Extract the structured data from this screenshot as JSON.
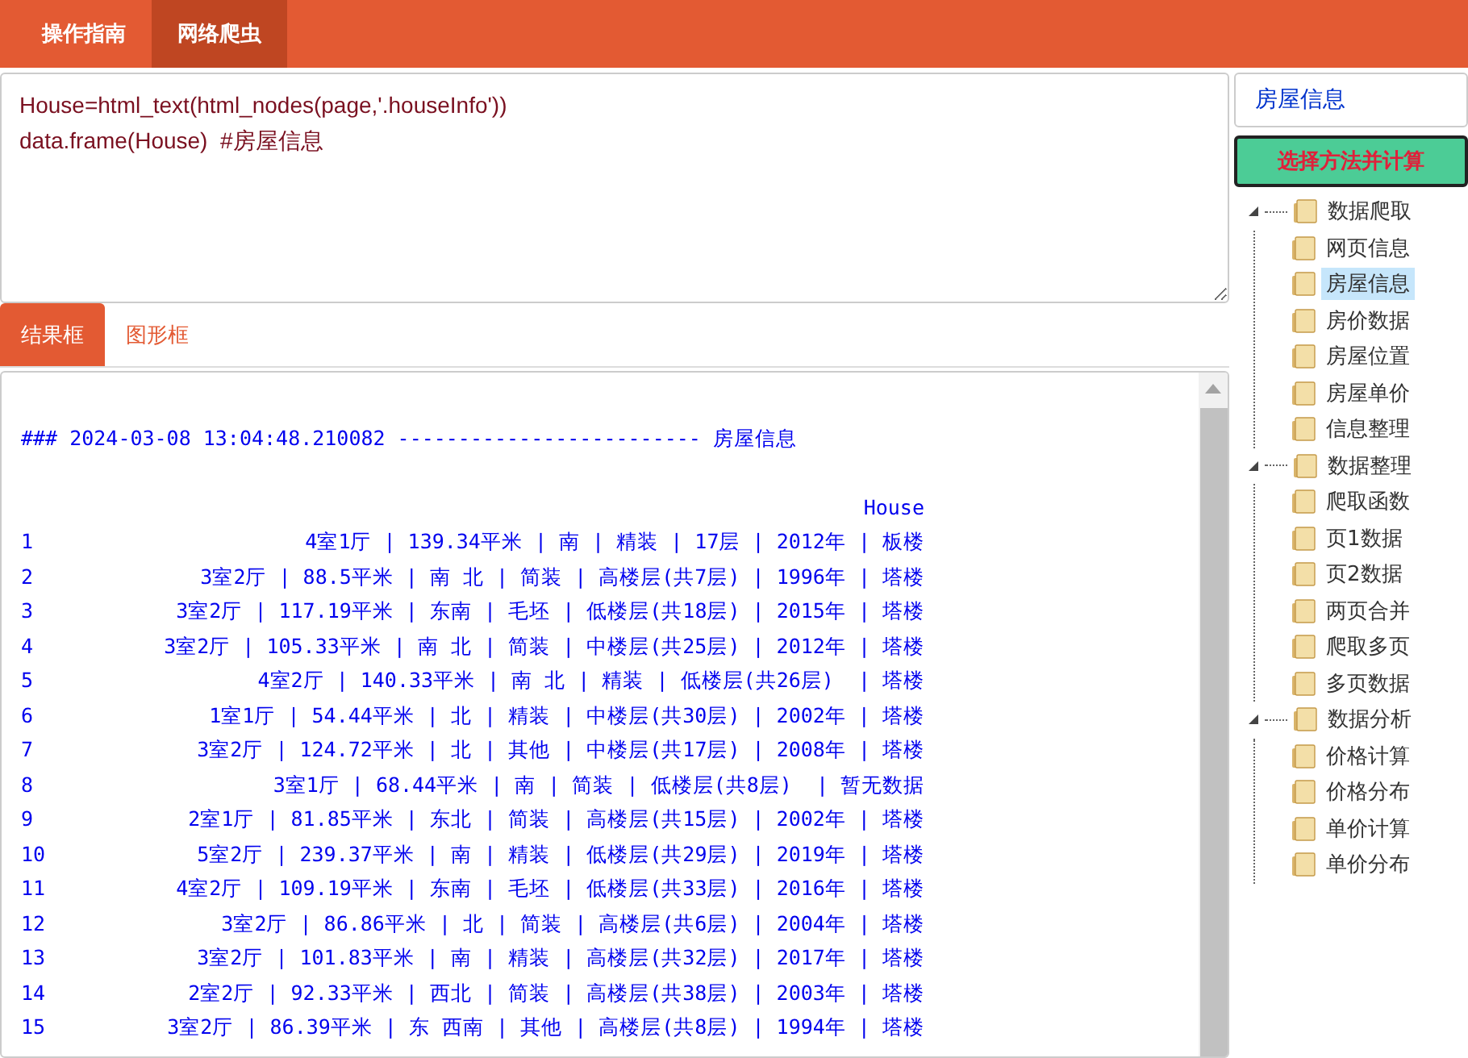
{
  "nav_tabs": [
    {
      "label": "操作指南",
      "selected": false
    },
    {
      "label": "网络爬虫",
      "selected": true
    }
  ],
  "editor": {
    "value": "House=html_text(html_nodes(page,'.houseInfo'))\ndata.frame(House)  #房屋信息"
  },
  "output_tabs": [
    {
      "label": "结果框",
      "selected": true
    },
    {
      "label": "图形框",
      "selected": false
    }
  ],
  "output": {
    "header": "### 2024-03-08 13:04:48.210082 ------------------------- 房屋信息",
    "column_header": "House",
    "rows": [
      {
        "index": "1",
        "text": "4室1厅 | 139.34平米 | 南 | 精装 | 17层 | 2012年 | 板楼"
      },
      {
        "index": "2",
        "text": "3室2厅 | 88.5平米 | 南 北 | 简装 | 高楼层(共7层) | 1996年 | 塔楼"
      },
      {
        "index": "3",
        "text": "3室2厅 | 117.19平米 | 东南 | 毛坯 | 低楼层(共18层) | 2015年 | 塔楼"
      },
      {
        "index": "4",
        "text": "3室2厅 | 105.33平米 | 南 北 | 简装 | 中楼层(共25层) | 2012年 | 塔楼"
      },
      {
        "index": "5",
        "text": "4室2厅 | 140.33平米 | 南 北 | 精装 | 低楼层(共26层)  | 塔楼"
      },
      {
        "index": "6",
        "text": "1室1厅 | 54.44平米 | 北 | 精装 | 中楼层(共30层) | 2002年 | 塔楼"
      },
      {
        "index": "7",
        "text": "3室2厅 | 124.72平米 | 北 | 其他 | 中楼层(共17层) | 2008年 | 塔楼"
      },
      {
        "index": "8",
        "text": "3室1厅 | 68.44平米 | 南 | 简装 | 低楼层(共8层)  | 暂无数据"
      },
      {
        "index": "9",
        "text": "2室1厅 | 81.85平米 | 东北 | 简装 | 高楼层(共15层) | 2002年 | 塔楼"
      },
      {
        "index": "10",
        "text": "5室2厅 | 239.37平米 | 南 | 精装 | 低楼层(共29层) | 2019年 | 塔楼"
      },
      {
        "index": "11",
        "text": "4室2厅 | 109.19平米 | 东南 | 毛坯 | 低楼层(共33层) | 2016年 | 塔楼"
      },
      {
        "index": "12",
        "text": "3室2厅 | 86.86平米 | 北 | 简装 | 高楼层(共6层) | 2004年 | 塔楼"
      },
      {
        "index": "13",
        "text": "3室2厅 | 101.83平米 | 南 | 精装 | 高楼层(共32层) | 2017年 | 塔楼"
      },
      {
        "index": "14",
        "text": "2室2厅 | 92.33平米 | 西北 | 简装 | 高楼层(共38层) | 2003年 | 塔楼"
      },
      {
        "index": "15",
        "text": "3室2厅 | 86.39平米 | 东 西南 | 其他 | 高楼层(共8层) | 1994年 | 塔楼"
      }
    ]
  },
  "sidebar": {
    "title": "房屋信息",
    "button": "选择方法并计算",
    "tree": [
      {
        "label": "数据爬取",
        "expanded": true,
        "children": [
          {
            "label": "网页信息",
            "selected": false
          },
          {
            "label": "房屋信息",
            "selected": true
          },
          {
            "label": "房价数据",
            "selected": false
          },
          {
            "label": "房屋位置",
            "selected": false
          },
          {
            "label": "房屋单价",
            "selected": false
          },
          {
            "label": "信息整理",
            "selected": false
          }
        ]
      },
      {
        "label": "数据整理",
        "expanded": true,
        "children": [
          {
            "label": "爬取函数",
            "selected": false
          },
          {
            "label": "页1数据",
            "selected": false
          },
          {
            "label": "页2数据",
            "selected": false
          },
          {
            "label": "两页合并",
            "selected": false
          },
          {
            "label": "爬取多页",
            "selected": false
          },
          {
            "label": "多页数据",
            "selected": false
          }
        ]
      },
      {
        "label": "数据分析",
        "expanded": true,
        "children": [
          {
            "label": "价格计算",
            "selected": false
          },
          {
            "label": "价格分布",
            "selected": false
          },
          {
            "label": "单价计算",
            "selected": false
          },
          {
            "label": "单价分布",
            "selected": false
          }
        ]
      }
    ]
  }
}
